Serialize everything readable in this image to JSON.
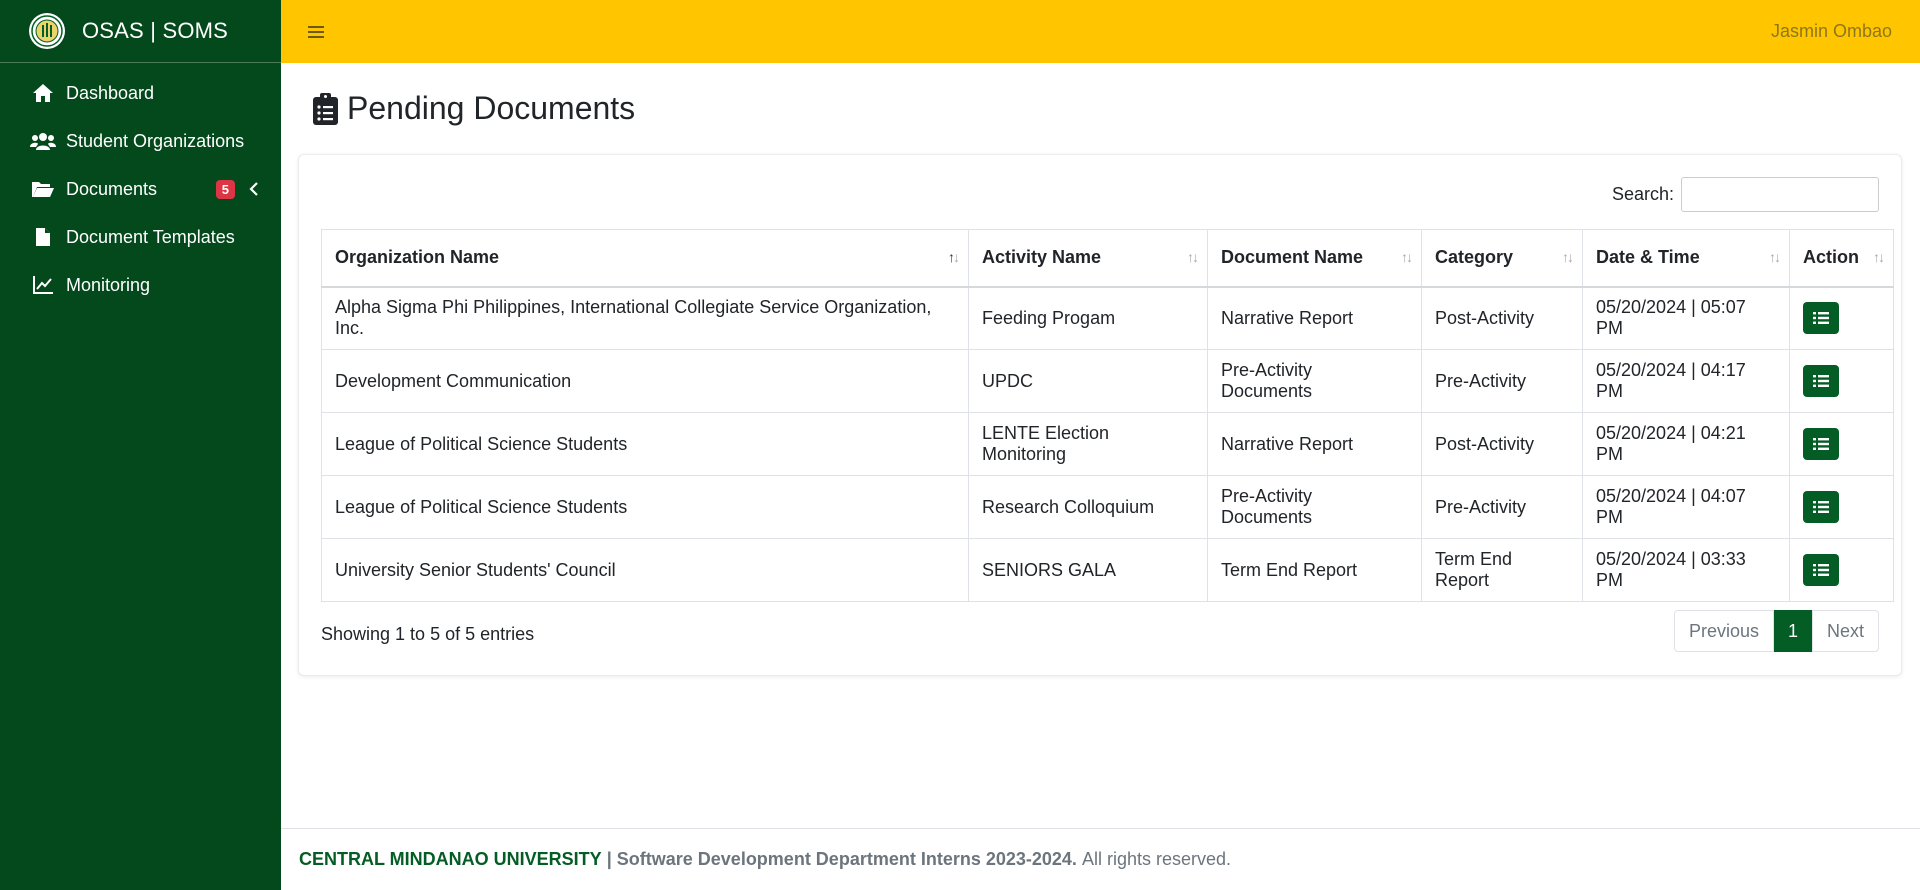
{
  "app": {
    "title": "OSAS | SOMS",
    "user": "Jasmin Ombao"
  },
  "sidebar": {
    "items": [
      {
        "label": "Dashboard",
        "icon": "home-icon"
      },
      {
        "label": "Student Organizations",
        "icon": "users-icon"
      },
      {
        "label": "Documents",
        "icon": "folder-open-icon",
        "badge": "5"
      },
      {
        "label": "Document Templates",
        "icon": "file-icon"
      },
      {
        "label": "Monitoring",
        "icon": "line-chart-icon"
      }
    ]
  },
  "page": {
    "title": "Pending Documents"
  },
  "search": {
    "label": "Search:",
    "value": ""
  },
  "table": {
    "headers": [
      "Organization Name",
      "Activity Name",
      "Document Name",
      "Category",
      "Date & Time",
      "Action"
    ],
    "rows": [
      [
        "Alpha Sigma Phi Philippines, International Collegiate Service Organization, Inc.",
        "Feeding Progam",
        "Narrative Report",
        "Post-Activity",
        "05/20/2024 | 05:07 PM"
      ],
      [
        "Development Communication",
        "UPDC",
        "Pre-Activity Documents",
        "Pre-Activity",
        "05/20/2024 | 04:17 PM"
      ],
      [
        "League of Political Science Students",
        "LENTE Election Monitoring",
        "Narrative Report",
        "Post-Activity",
        "05/20/2024 | 04:21 PM"
      ],
      [
        "League of Political Science Students",
        "Research Colloquium",
        "Pre-Activity Documents",
        "Pre-Activity",
        "05/20/2024 | 04:07 PM"
      ],
      [
        "University Senior Students' Council",
        "SENIORS GALA",
        "Term End Report",
        "Term End Report",
        "05/20/2024 | 03:33 PM"
      ]
    ]
  },
  "table_info": "Showing 1 to 5 of 5 entries",
  "pagination": {
    "previous": "Previous",
    "current": "1",
    "next": "Next"
  },
  "footer": {
    "university": "CENTRAL MINDANAO UNIVERSITY",
    "separator": "|",
    "department": "Software Development Department Interns 2023-2024.",
    "rights": "All rights reserved."
  },
  "colors": {
    "sidebar_bg": "#03491c",
    "topbar_bg": "#ffc600",
    "accent_green": "#045d24",
    "badge_red": "#dc3545"
  }
}
